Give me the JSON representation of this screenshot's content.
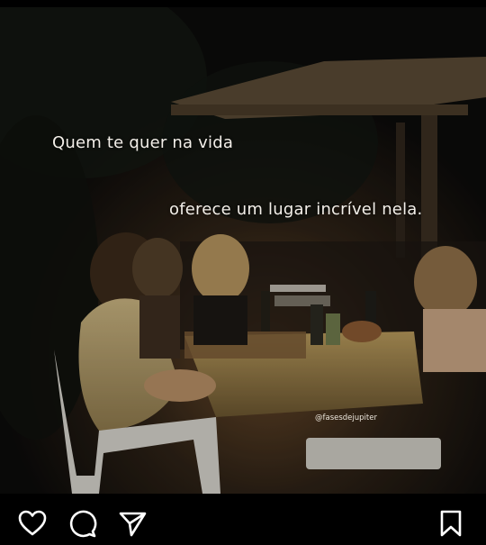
{
  "post": {
    "caption_line1": "Quem te quer na vida",
    "caption_line2": "oferece um lugar incrível nela.",
    "watermark": "@fasesdejupiter"
  },
  "actions": {
    "like_icon": "heart-icon",
    "comment_icon": "comment-icon",
    "share_icon": "paper-plane-icon",
    "save_icon": "bookmark-icon"
  },
  "colors": {
    "background": "#000000",
    "icon": "#ffffff",
    "caption_text": "#f3efe9"
  }
}
